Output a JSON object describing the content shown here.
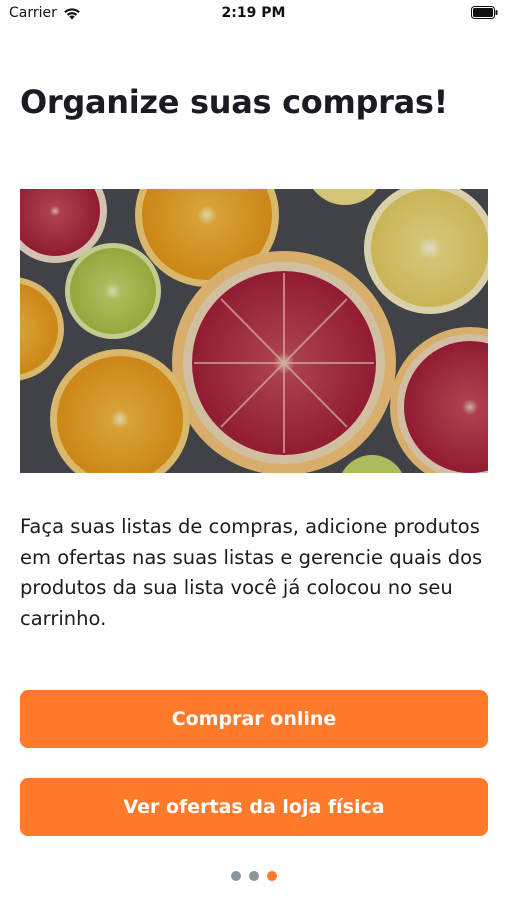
{
  "status_bar": {
    "carrier": "Carrier",
    "time": "2:19 PM",
    "icons": [
      "wifi-icon",
      "battery-icon"
    ]
  },
  "onboarding": {
    "title": "Organize suas compras!",
    "description": "Faça suas listas de compras, adicione produtos em ofertas nas suas listas e gerencie quais dos produtos da sua lista você já colocou no seu carrinho.",
    "hero_image": "citrus-slices-image",
    "primary_button": "Comprar online",
    "secondary_button": "Ver ofertas da loja física",
    "pages_total": 3,
    "current_page": 3
  },
  "colors": {
    "accent": "#ff7a2b",
    "title_text": "#1b1b24",
    "dot_inactive": "#8b959b",
    "background": "#ffffff"
  }
}
